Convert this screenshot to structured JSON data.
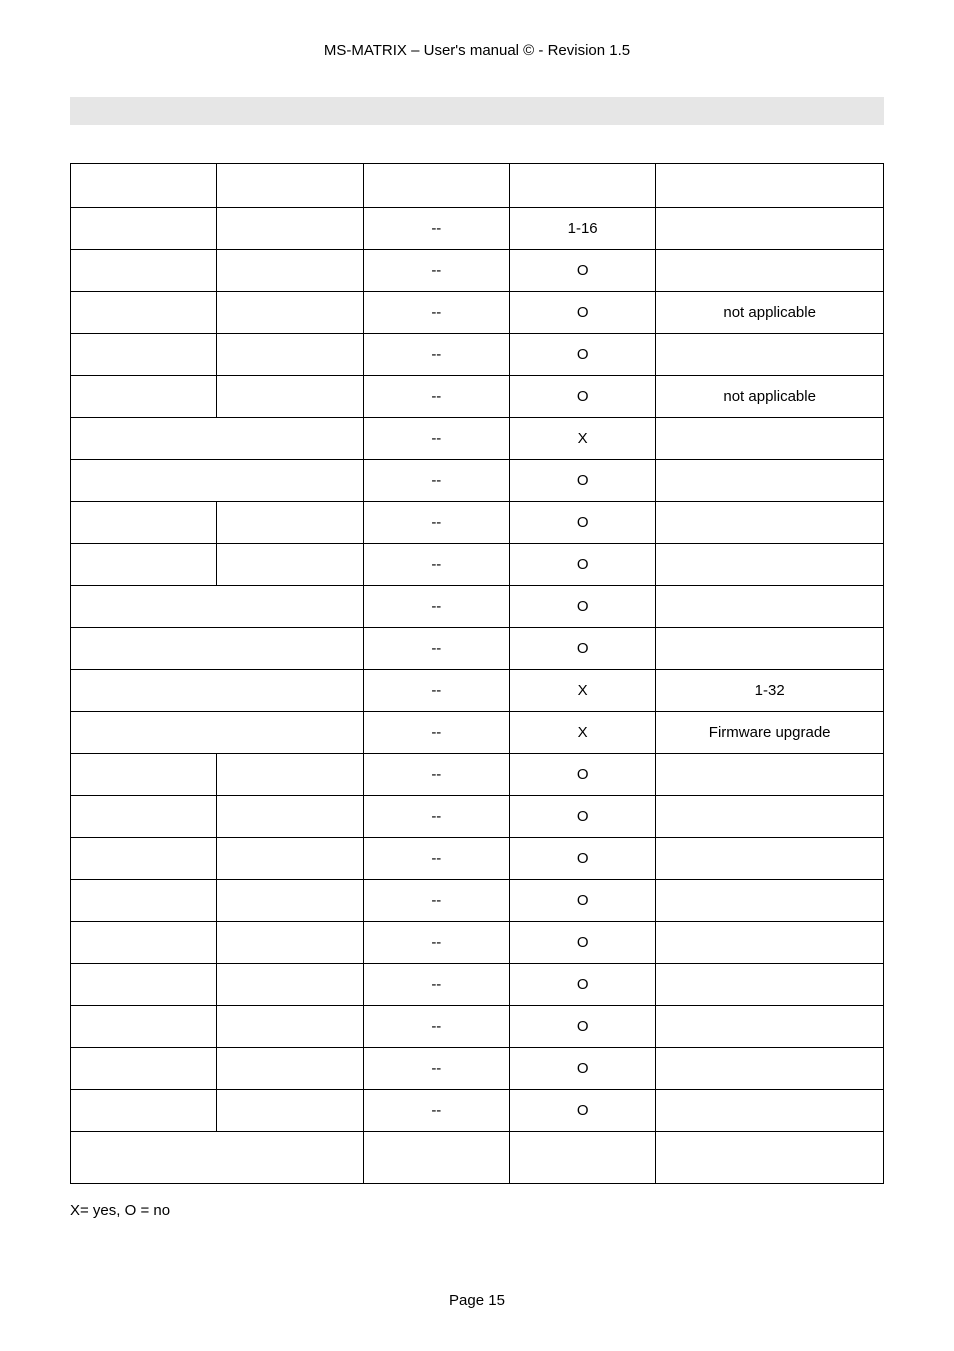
{
  "header": "MS-MATRIX   –   User's manual ©  -  Revision 1.5",
  "legend": "X= yes, O = no",
  "footer": "Page 15",
  "table": {
    "headers": [
      "",
      "",
      "",
      "",
      ""
    ],
    "rows": [
      {
        "cells": [
          "",
          "",
          "--",
          "1-16",
          ""
        ]
      },
      {
        "cells": [
          "",
          "",
          "--",
          "O",
          ""
        ]
      },
      {
        "cells": [
          "",
          "",
          "--",
          "O",
          "not applicable"
        ]
      },
      {
        "cells": [
          "",
          "",
          "--",
          "O",
          ""
        ]
      },
      {
        "cells": [
          "",
          "",
          "--",
          "O",
          "not applicable"
        ]
      },
      {
        "span": 2,
        "cells": [
          "",
          "--",
          "X",
          ""
        ]
      },
      {
        "span": 2,
        "cells": [
          "",
          "--",
          "O",
          ""
        ]
      },
      {
        "cells": [
          "",
          "",
          "--",
          "O",
          ""
        ]
      },
      {
        "cells": [
          "",
          "",
          "--",
          "O",
          ""
        ]
      },
      {
        "span": 2,
        "cells": [
          "",
          "--",
          "O",
          ""
        ]
      },
      {
        "span": 2,
        "cells": [
          "",
          "--",
          "O",
          ""
        ]
      },
      {
        "span": 2,
        "cells": [
          "",
          "--",
          "X",
          "1-32"
        ]
      },
      {
        "span": 2,
        "cells": [
          "",
          "--",
          "X",
          "Firmware upgrade"
        ]
      },
      {
        "cells": [
          "",
          "",
          "--",
          "O",
          ""
        ]
      },
      {
        "cells": [
          "",
          "",
          "--",
          "O",
          ""
        ]
      },
      {
        "cells": [
          "",
          "",
          "--",
          "O",
          ""
        ]
      },
      {
        "cells": [
          "",
          "",
          "--",
          "O",
          ""
        ]
      },
      {
        "cells": [
          "",
          "",
          "--",
          "O",
          ""
        ]
      },
      {
        "cells": [
          "",
          "",
          "--",
          "O",
          ""
        ]
      },
      {
        "cells": [
          "",
          "",
          "--",
          "O",
          ""
        ]
      },
      {
        "cells": [
          "",
          "",
          "--",
          "O",
          ""
        ]
      },
      {
        "cells": [
          "",
          "",
          "--",
          "O",
          ""
        ]
      },
      {
        "span": 2,
        "cells": [
          "",
          "",
          "",
          ""
        ],
        "tall": true
      }
    ]
  }
}
